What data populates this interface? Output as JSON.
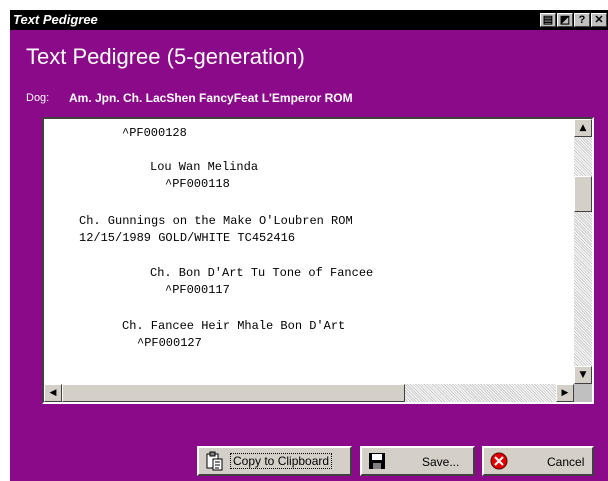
{
  "window": {
    "title": "Text Pedigree"
  },
  "titlebar_buttons": [
    {
      "name": "print-preview-icon",
      "symbol": "▤"
    },
    {
      "name": "context-help-icon",
      "symbol": "◩"
    },
    {
      "name": "help-icon",
      "symbol": "?"
    },
    {
      "name": "close-icon",
      "symbol": "✕"
    }
  ],
  "heading": "Text Pedigree (5-generation)",
  "dog": {
    "label": "Dog:",
    "value": "Am. Jpn. Ch. LacShen FancyFeat L'Emperor ROM"
  },
  "pedigree_lines": [
    "^PF000128",
    "Lou Wan Melinda",
    "^PF000118",
    "Ch. Gunnings on the Make O'Loubren ROM",
    "12/15/1989 GOLD/WHITE TC452416",
    "Ch. Bon D'Art Tu Tone of Fancee",
    "^PF000117",
    "Ch. Fancee Heir Mhale Bon D'Art",
    "^PF000127"
  ],
  "scroll": {
    "up": "▲",
    "down": "▼",
    "left": "◀",
    "right": "▶"
  },
  "buttons": {
    "copy": "Copy to Clipboard",
    "save": "Save...",
    "cancel": "Cancel"
  },
  "colors": {
    "window_bg": "#8a0a8a",
    "titlebar_bg": "#000000"
  }
}
